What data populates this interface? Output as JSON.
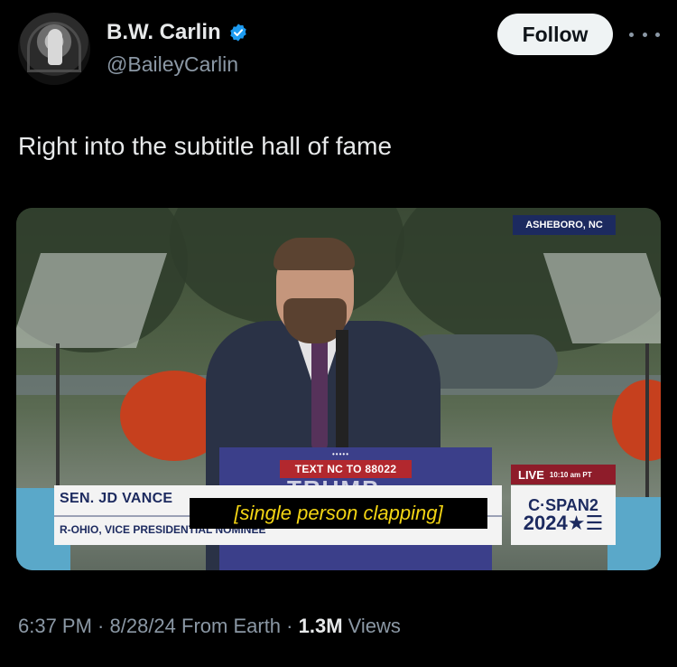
{
  "author": {
    "display_name": "B.W. Carlin",
    "handle": "@BaileyCarlin",
    "verified": true,
    "verified_color": "#1d9bf0"
  },
  "actions": {
    "follow_label": "Follow",
    "more_icon": "more-horizontal-icon"
  },
  "tweet": {
    "text": "Right into the subtitle hall of fame"
  },
  "media": {
    "location": "ASHEBORO, NC",
    "live_label": "LIVE",
    "live_time": "10:10 am PT",
    "podium_sign": "TEXT NC TO 88022",
    "podium_stars": "•••••",
    "podium_word": "TRUMP",
    "lower_third_name": "SEN. JD VANCE",
    "lower_third_title": "R-OHIO, VICE PRESIDENTIAL NOMINEE",
    "network_line1": "C·SPAN2",
    "network_line2": "2024★☰",
    "subtitle": "[single person clapping]",
    "subtitle_color": "#f3d514"
  },
  "meta": {
    "time": "6:37 PM",
    "sep1": " · ",
    "date": "8/28/24",
    "source": " From Earth",
    "sep2": " · ",
    "views_count": "1.3M",
    "views_label": " Views"
  }
}
